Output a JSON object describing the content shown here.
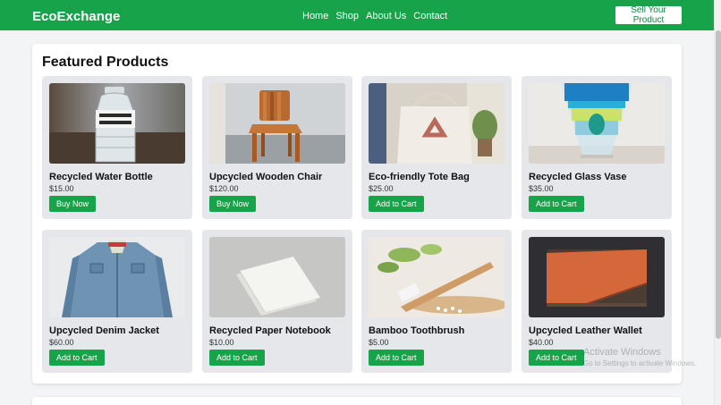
{
  "nav": {
    "brand": "EcoExchange",
    "links": [
      "Home",
      "Shop",
      "About Us",
      "Contact"
    ],
    "sell_label": "Sell Your Product"
  },
  "section": {
    "title": "Featured Products"
  },
  "products": [
    {
      "name": "Recycled Water Bottle",
      "price": "$15.00",
      "button": "Buy Now",
      "image_icon": "water-bottle-icon"
    },
    {
      "name": "Upcycled Wooden Chair",
      "price": "$120.00",
      "button": "Buy Now",
      "image_icon": "wooden-chair-icon"
    },
    {
      "name": "Eco-friendly Tote Bag",
      "price": "$25.00",
      "button": "Add to Cart",
      "image_icon": "tote-bag-icon"
    },
    {
      "name": "Recycled Glass Vase",
      "price": "$35.00",
      "button": "Add to Cart",
      "image_icon": "glass-vase-icon"
    },
    {
      "name": "Upcycled Denim Jacket",
      "price": "$60.00",
      "button": "Add to Cart",
      "image_icon": "denim-jacket-icon"
    },
    {
      "name": "Recycled Paper Notebook",
      "price": "$10.00",
      "button": "Add to Cart",
      "image_icon": "notebook-icon"
    },
    {
      "name": "Bamboo Toothbrush",
      "price": "$5.00",
      "button": "Add to Cart",
      "image_icon": "toothbrush-icon"
    },
    {
      "name": "Upcycled Leather Wallet",
      "price": "$40.00",
      "button": "Add to Cart",
      "image_icon": "wallet-icon"
    }
  ],
  "watermark": {
    "title": "Activate Windows",
    "subtitle": "Go to Settings to activate Windows."
  },
  "colors": {
    "brand": "#16a34a",
    "panel_bg": "#ffffff",
    "card_bg": "#e5e7eb",
    "page_bg": "#f3f4f6"
  }
}
